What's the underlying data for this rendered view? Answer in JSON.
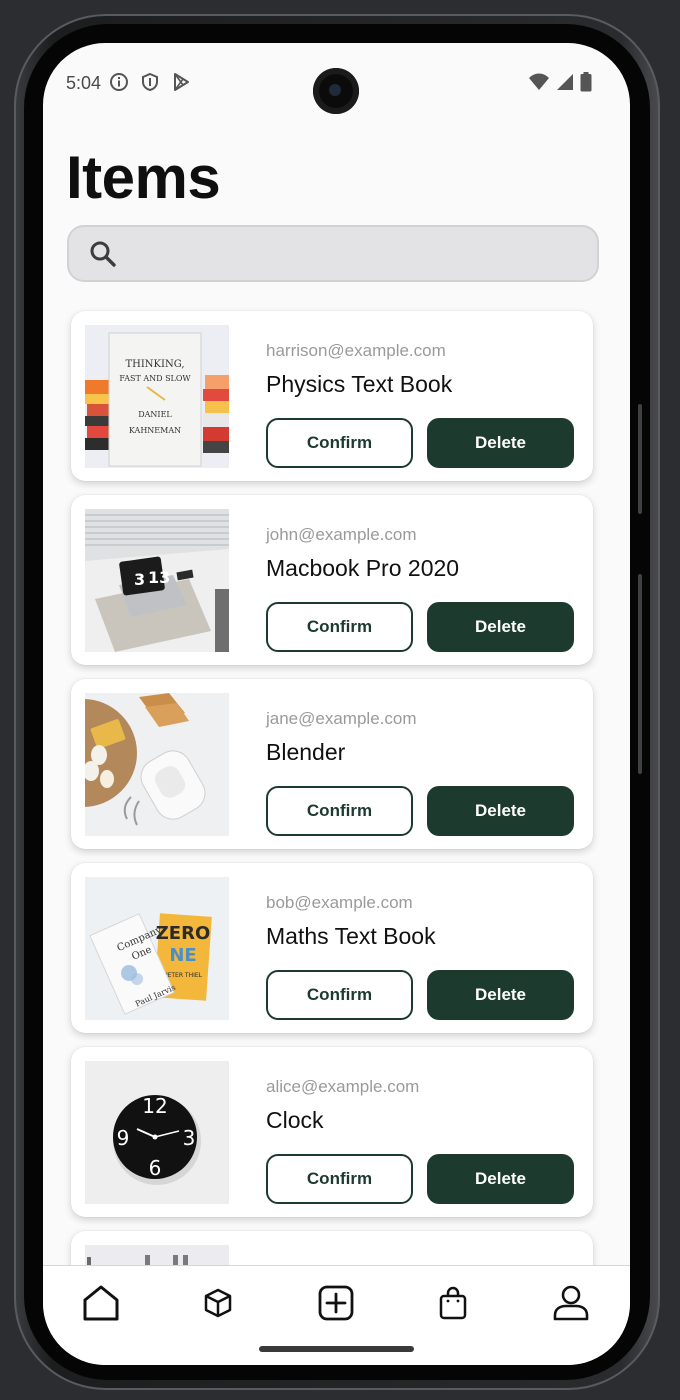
{
  "status_bar": {
    "time": "5:04",
    "left_icons": [
      "info-icon",
      "shield-icon",
      "play-store-icon"
    ],
    "right_icons": [
      "wifi-icon",
      "signal-icon",
      "battery-icon"
    ]
  },
  "header": {
    "title": "Items"
  },
  "search": {
    "placeholder": "",
    "value": ""
  },
  "items": [
    {
      "email": "harrison@example.com",
      "title": "Physics Text Book",
      "confirm_label": "Confirm",
      "delete_label": "Delete",
      "image": "books-stack-photo"
    },
    {
      "email": "john@example.com",
      "title": "Macbook Pro 2020",
      "confirm_label": "Confirm",
      "delete_label": "Delete",
      "image": "laptop-desk-photo"
    },
    {
      "email": "jane@example.com",
      "title": "Blender",
      "confirm_label": "Confirm",
      "delete_label": "Delete",
      "image": "hand-mixer-photo"
    },
    {
      "email": "bob@example.com",
      "title": "Maths Text Book",
      "confirm_label": "Confirm",
      "delete_label": "Delete",
      "image": "two-books-photo"
    },
    {
      "email": "alice@example.com",
      "title": "Clock",
      "confirm_label": "Confirm",
      "delete_label": "Delete",
      "image": "wall-clock-photo"
    }
  ],
  "bottom_nav": {
    "items": [
      {
        "icon": "home-icon",
        "active": true
      },
      {
        "icon": "cube-icon",
        "active": false
      },
      {
        "icon": "add-square-icon",
        "active": false
      },
      {
        "icon": "shopping-bag-icon",
        "active": false
      },
      {
        "icon": "profile-icon",
        "active": false
      }
    ]
  },
  "colors": {
    "accent": "#1c3a2e",
    "background": "#fafafa",
    "card": "#ffffff",
    "email_text": "#9a9a9a"
  }
}
